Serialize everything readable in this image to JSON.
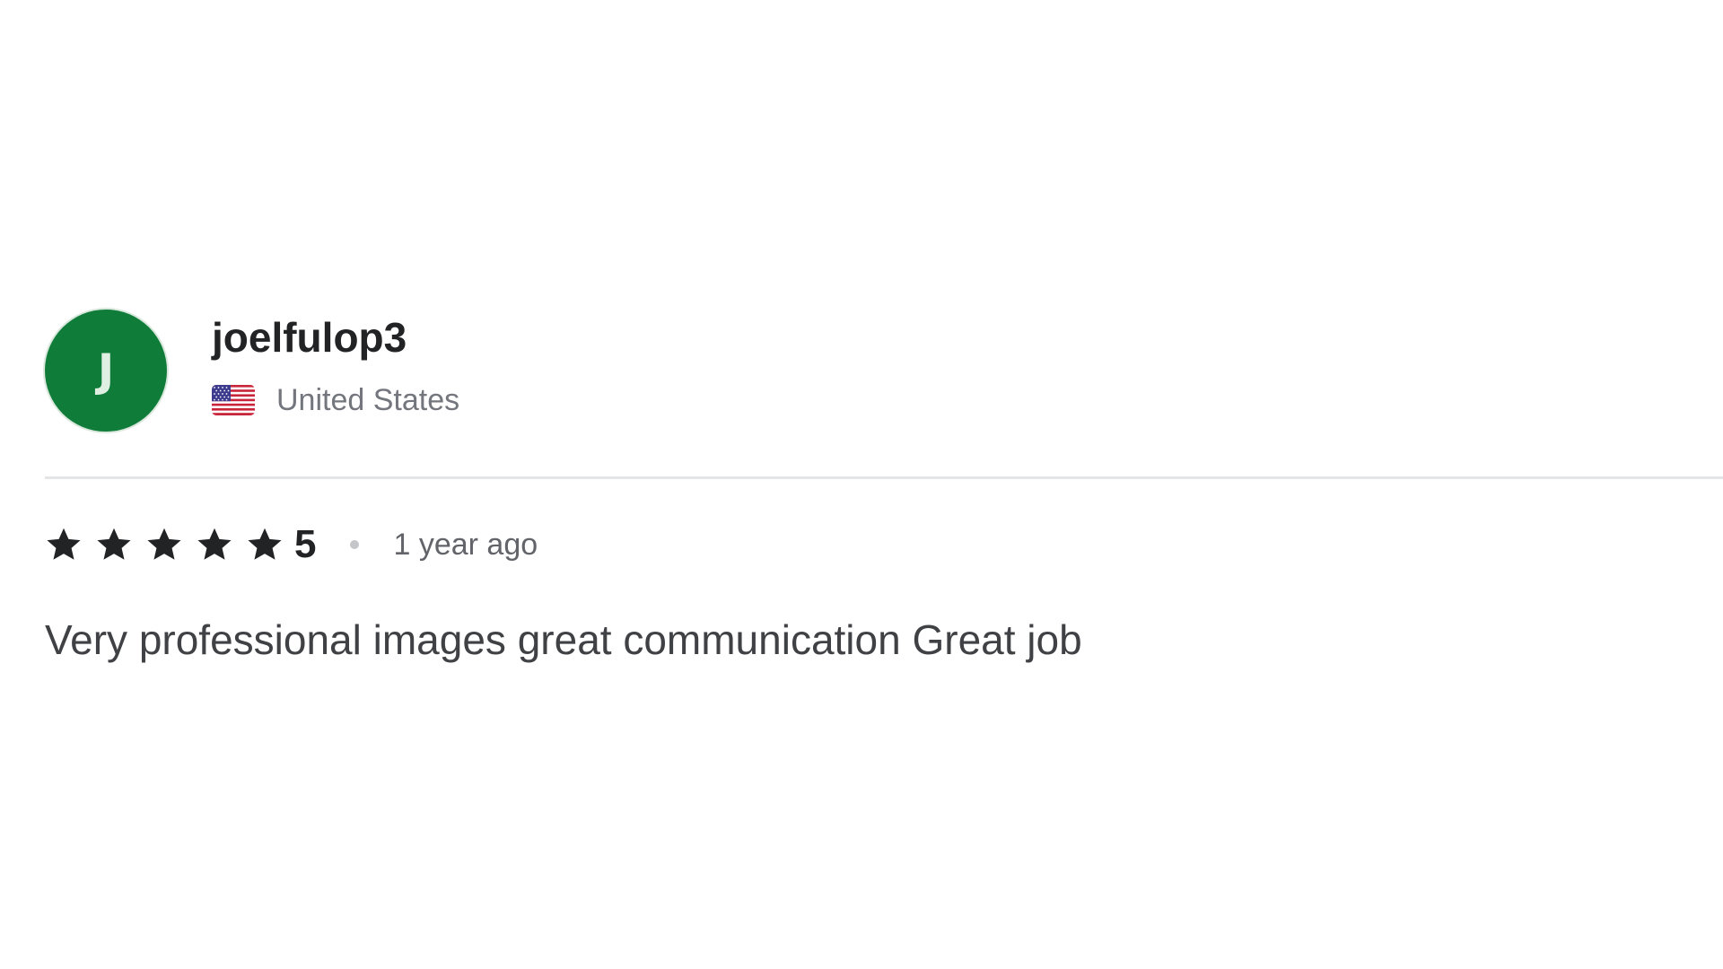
{
  "review": {
    "reviewer": {
      "initial": "J",
      "name": "joelfulop3",
      "country": "United States",
      "flag_icon": "us-flag-icon",
      "avatar_color": "#107c3a"
    },
    "rating": {
      "value": "5",
      "stars_filled": 5,
      "stars_total": 5,
      "star_icon": "star-icon"
    },
    "time_ago": "1 year ago",
    "text": "Very professional images great communication Great job"
  }
}
